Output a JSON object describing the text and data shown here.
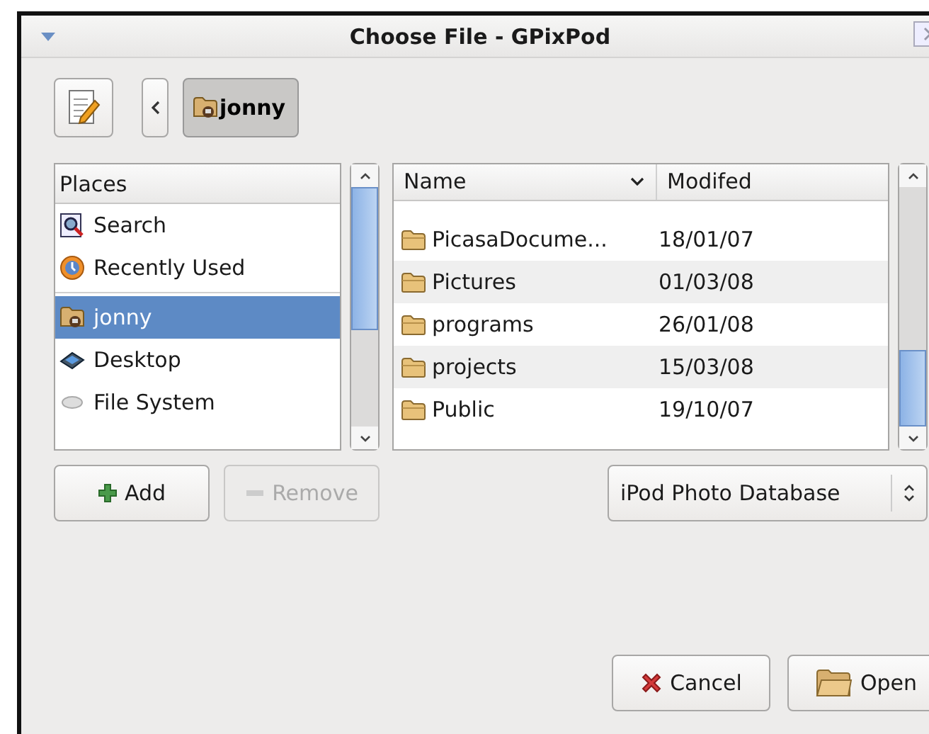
{
  "window": {
    "title": "Choose File - GPixPod"
  },
  "path_bar": {
    "segments": [
      {
        "label": "jonny",
        "selected": true
      }
    ]
  },
  "places": {
    "header": "Places",
    "items": [
      {
        "label": "Search",
        "kind": "search",
        "selected": false
      },
      {
        "label": "Recently Used",
        "kind": "recent",
        "selected": false
      },
      {
        "label": "jonny",
        "kind": "home",
        "selected": true,
        "separator_before": true
      },
      {
        "label": "Desktop",
        "kind": "desktop",
        "selected": false
      },
      {
        "label": "File System",
        "kind": "drive",
        "selected": false
      }
    ]
  },
  "files": {
    "columns": [
      "Name",
      "Modifed"
    ],
    "rows": [
      {
        "name": "PicasaDocume...",
        "modified": "18/01/07",
        "selected": false
      },
      {
        "name": "Pictures",
        "modified": "01/03/08",
        "selected": false
      },
      {
        "name": "programs",
        "modified": "26/01/08",
        "selected": false
      },
      {
        "name": "projects",
        "modified": "15/03/08",
        "selected": false
      },
      {
        "name": "Public",
        "modified": "19/10/07",
        "selected": false
      }
    ]
  },
  "place_buttons": [
    {
      "label": "Add",
      "kind": "add",
      "disabled": false
    },
    {
      "label": "Remove",
      "kind": "remove",
      "disabled": true
    }
  ],
  "filter": {
    "value": "iPod Photo Database"
  },
  "buttons": [
    {
      "label": "Cancel",
      "kind": "cancel"
    },
    {
      "label": "Open",
      "kind": "open"
    }
  ]
}
